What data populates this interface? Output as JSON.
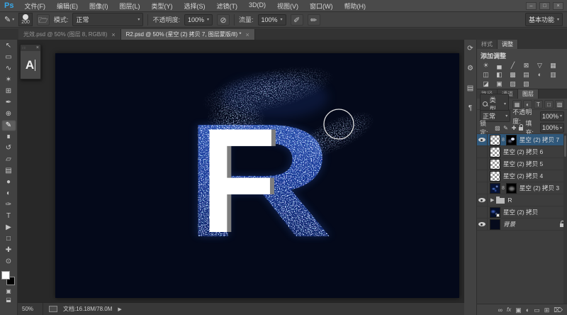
{
  "menu": {
    "logo": "Ps",
    "items": [
      "文件(F)",
      "编辑(E)",
      "图像(I)",
      "图层(L)",
      "类型(Y)",
      "选择(S)",
      "滤镜(T)",
      "3D(D)",
      "视图(V)",
      "窗口(W)",
      "帮助(H)"
    ],
    "controls": [
      {
        "name": "minimize-button",
        "glyph": "–"
      },
      {
        "name": "maximize-button",
        "glyph": "□"
      },
      {
        "name": "close-button",
        "glyph": "×"
      }
    ]
  },
  "options_bar": {
    "brush_size": "200",
    "mode_label": "模式:",
    "mode_value": "正常",
    "opacity_label": "不透明度:",
    "opacity_value": "100%",
    "flow_label": "流量:",
    "flow_value": "100%",
    "workspace": "基本功能",
    "dropdown_glyph": "▾"
  },
  "document_tabs": [
    {
      "label": "光效.psd @ 50% (图层 8, RGB/8)",
      "close": "×"
    },
    {
      "label": "R2.psd @ 50% (星空 (2) 拷贝 7, 图层蒙版/8) *",
      "close": "×",
      "active": true
    }
  ],
  "toolbar": {
    "tools": [
      {
        "name": "move-tool",
        "glyph": "↖"
      },
      {
        "name": "marquee-tool",
        "glyph": "▭"
      },
      {
        "name": "lasso-tool",
        "glyph": "∿"
      },
      {
        "name": "magic-wand-tool",
        "glyph": "✶"
      },
      {
        "name": "crop-tool",
        "glyph": "⊞"
      },
      {
        "name": "eyedropper-tool",
        "glyph": "✒"
      },
      {
        "name": "healing-brush-tool",
        "glyph": "⊕"
      },
      {
        "name": "brush-tool",
        "glyph": "✎",
        "sel": "selected"
      },
      {
        "name": "clone-stamp-tool",
        "glyph": "∎"
      },
      {
        "name": "history-brush-tool",
        "glyph": "↺"
      },
      {
        "name": "eraser-tool",
        "glyph": "▱"
      },
      {
        "name": "gradient-tool",
        "glyph": "▤"
      },
      {
        "name": "blur-tool",
        "glyph": "●"
      },
      {
        "name": "dodge-tool",
        "glyph": "◐"
      },
      {
        "name": "pen-tool",
        "glyph": "✑"
      },
      {
        "name": "type-tool",
        "glyph": "T"
      },
      {
        "name": "path-selection-tool",
        "glyph": "▶"
      },
      {
        "name": "rectangle-tool",
        "glyph": "□"
      },
      {
        "name": "hand-tool",
        "glyph": "✚"
      },
      {
        "name": "zoom-tool",
        "glyph": "⊙"
      }
    ]
  },
  "mini_panel": {
    "letter": "A",
    "close": "×",
    "dots": "::::"
  },
  "rail_icons": [
    {
      "name": "history-panel-icon",
      "glyph": "⟳"
    },
    {
      "name": "gear-panel-icon",
      "glyph": "⚙"
    },
    {
      "name": "swatches-panel-icon",
      "glyph": "▤"
    },
    {
      "name": "paragraph-panel-icon",
      "glyph": "¶"
    }
  ],
  "adjustments_panel": {
    "tabs": [
      {
        "label": "样式"
      },
      {
        "label": "调整",
        "active": true
      }
    ],
    "title": "添加调整",
    "icons": [
      {
        "name": "adj-brightness-icon",
        "glyph": "☀"
      },
      {
        "name": "adj-levels-icon",
        "glyph": "▄"
      },
      {
        "name": "adj-curves-icon",
        "glyph": "╱"
      },
      {
        "name": "adj-exposure-icon",
        "glyph": "⊠"
      },
      {
        "name": "adj-vibrance-icon",
        "glyph": "▽"
      },
      {
        "name": "adj-hue-icon",
        "glyph": "▦"
      },
      {
        "name": "adj-colorbalance-icon",
        "glyph": "◫"
      },
      {
        "name": "adj-blackwhite-icon",
        "glyph": "◧"
      },
      {
        "name": "adj-photofilter-icon",
        "glyph": "▩"
      },
      {
        "name": "adj-channelmixer-icon",
        "glyph": "▤"
      },
      {
        "name": "adj-invert-icon",
        "glyph": "◐"
      },
      {
        "name": "adj-posterize-icon",
        "glyph": "▥"
      },
      {
        "name": "adj-threshold-icon",
        "glyph": "◪"
      },
      {
        "name": "adj-gradientmap-icon",
        "glyph": "▣"
      },
      {
        "name": "adj-selectivecolor-icon",
        "glyph": "▨"
      },
      {
        "name": "adj-lookup-icon",
        "glyph": "▧"
      }
    ]
  },
  "layers_panel": {
    "tabs": [
      {
        "label": "路径"
      },
      {
        "label": "通道"
      },
      {
        "label": "图层",
        "active": true
      }
    ],
    "filter": {
      "type_label": "类型",
      "icons": [
        {
          "name": "filter-pixel-icon",
          "glyph": "▦"
        },
        {
          "name": "filter-adjustment-icon",
          "glyph": "◐"
        },
        {
          "name": "filter-type-icon",
          "glyph": "T"
        },
        {
          "name": "filter-shape-icon",
          "glyph": "□"
        },
        {
          "name": "filter-smart-icon",
          "glyph": "▧"
        }
      ]
    },
    "blend_mode": "正常",
    "opacity_label": "不透明度:",
    "opacity_value": "100%",
    "lock_label": "锁定:",
    "lock_icons": [
      {
        "name": "lock-transparency-icon",
        "glyph": "▨"
      },
      {
        "name": "lock-pixels-icon",
        "glyph": "✎"
      },
      {
        "name": "lock-position-icon",
        "glyph": "✚"
      }
    ],
    "fill_label": "填充:",
    "fill_value": "100%",
    "layers": [
      {
        "name": "星空 (2) 拷贝 7",
        "eye": true,
        "sel": "selected",
        "thumb": "checker",
        "link": "8",
        "mask": "blob"
      },
      {
        "name": "星空 (2) 拷贝 6",
        "thumb": "checker"
      },
      {
        "name": "星空 (2) 拷贝 5",
        "thumb": "checker"
      },
      {
        "name": "星空 (2) 拷贝 4",
        "thumb": "checker"
      },
      {
        "name": "星空 (2) 拷贝 3",
        "thumb": "galaxy",
        "link": "8",
        "mask": "galaxy"
      },
      {
        "name": "R",
        "eye": true,
        "group": true,
        "arrow": "▶"
      },
      {
        "name": "星空 (2) 拷贝",
        "thumb": "galaxy2",
        "corner": true
      },
      {
        "name": "背景",
        "eye": true,
        "thumb": "navy",
        "italic": "italic",
        "locked": true
      }
    ],
    "bottom_icons": [
      {
        "name": "link-layers-icon",
        "glyph": "∞"
      },
      {
        "name": "layer-style-icon",
        "glyph": "fx",
        "fx": true
      },
      {
        "name": "add-mask-icon",
        "glyph": "▣"
      },
      {
        "name": "new-adjustment-layer-icon",
        "glyph": "◐"
      },
      {
        "name": "new-group-icon",
        "glyph": "▭"
      },
      {
        "name": "new-layer-icon",
        "glyph": "⊞"
      },
      {
        "name": "delete-layer-icon",
        "glyph": "⌦"
      }
    ]
  },
  "status_bar": {
    "zoom": "50%",
    "doc_info": "文档:16.18M/78.0M",
    "arrow": "▶"
  },
  "artwork": {
    "letter_main": "R",
    "letter_overlay": "F",
    "canvas_bg": "#04091a",
    "star_blue": "#1e47b4",
    "selection_blue": "#30587a"
  }
}
